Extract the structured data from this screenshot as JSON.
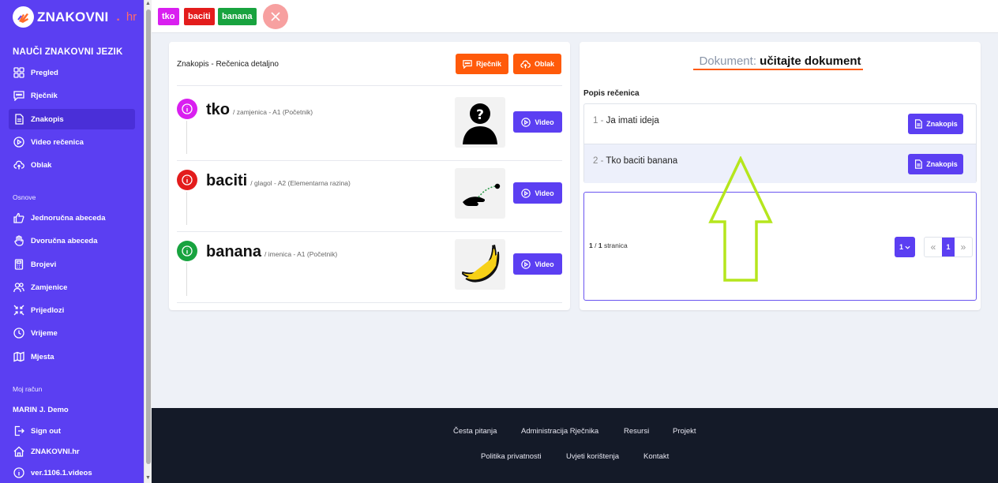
{
  "brand": {
    "name": "ZNAKOVNI",
    "tld": "hr"
  },
  "sidebar": {
    "main_title": "NAUČI ZNAKOVNI JEZIK",
    "main_items": [
      {
        "label": "Pregled",
        "icon": "grid-icon"
      },
      {
        "label": "Rječnik",
        "icon": "chat-icon"
      },
      {
        "label": "Znakopis",
        "icon": "document-icon"
      },
      {
        "label": "Video rečenica",
        "icon": "play-icon"
      },
      {
        "label": "Oblak",
        "icon": "cloud-upload-icon"
      }
    ],
    "basics_title": "Osnove",
    "basics_items": [
      {
        "label": "Jednoručna abeceda",
        "icon": "thumb-icon"
      },
      {
        "label": "Dvoručna abeceda",
        "icon": "hand-icon"
      },
      {
        "label": "Brojevi",
        "icon": "calculator-icon"
      },
      {
        "label": "Zamjenice",
        "icon": "people-icon"
      },
      {
        "label": "Prijedlozi",
        "icon": "arrows-inward-icon"
      },
      {
        "label": "Vrijeme",
        "icon": "clock-icon"
      },
      {
        "label": "Mjesta",
        "icon": "map-icon"
      }
    ],
    "account_title": "Moj račun",
    "user_name": "MARIN J. Demo",
    "account_items": [
      {
        "label": "Sign out",
        "icon": "sign-out-icon"
      },
      {
        "label": "ZNAKOVNI.hr",
        "icon": "home-icon"
      },
      {
        "label": "ver.1106.1.videos",
        "icon": "info-icon"
      }
    ]
  },
  "topbar": {
    "chips": [
      {
        "label": "tko",
        "color": "#d91ff0"
      },
      {
        "label": "baciti",
        "color": "#e31c1c"
      },
      {
        "label": "banana",
        "color": "#18a33f"
      }
    ]
  },
  "left_card": {
    "title": "Znakopis - Rečenica detaljno",
    "dictionary_button": "Rječnik",
    "cloud_button": "Oblak",
    "words": [
      {
        "word": "tko",
        "meta": "/ zamjenica - A1 (Početnik)",
        "color": "#d91ff0",
        "video_label": "Video"
      },
      {
        "word": "baciti",
        "meta": "/ glagol - A2 (Elementarna razina)",
        "color": "#e31c1c",
        "video_label": "Video"
      },
      {
        "word": "banana",
        "meta": "/ imenica - A1 (Početnik)",
        "color": "#18a33f",
        "video_label": "Video"
      }
    ]
  },
  "right_card": {
    "document_label": "Dokument:",
    "document_value": "učitajte dokument",
    "list_title": "Popis rečenica",
    "sentences": [
      {
        "num": "1 -",
        "text": "Ja imati ideja",
        "button": "Znakopis"
      },
      {
        "num": "2 -",
        "text": "Tko baciti banana",
        "button": "Znakopis"
      }
    ],
    "pager": {
      "current": "1",
      "total": "1",
      "label": "stranica",
      "select_value": "1",
      "page": "1"
    }
  },
  "footer": {
    "row1": [
      "Česta pitanja",
      "Administracija Rječnika",
      "Resursi",
      "Projekt"
    ],
    "row2": [
      "Politika privatnosti",
      "Uvjeti korištenja",
      "Kontakt"
    ]
  },
  "colors": {
    "primary": "#5b3ff2",
    "orange": "#ff5a0a",
    "footer": "#141a28",
    "arrow": "#b5e61d"
  }
}
